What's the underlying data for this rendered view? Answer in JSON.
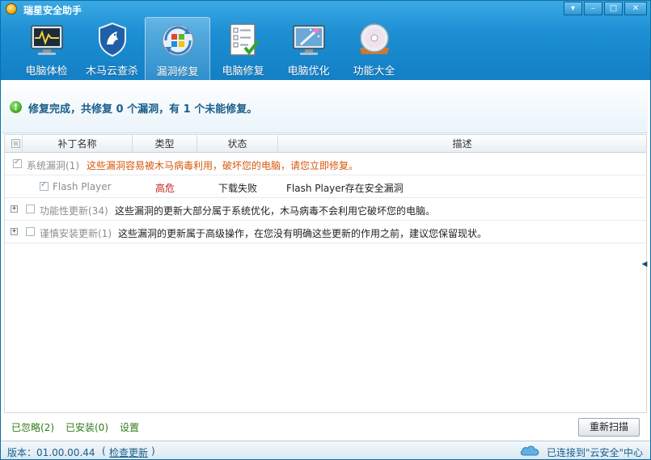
{
  "window": {
    "title": "瑞星安全助手",
    "controls": [
      "▾",
      "–",
      "□",
      "✕"
    ]
  },
  "nav": {
    "items": [
      {
        "label": "电脑体检",
        "icon": "monitor-health-icon"
      },
      {
        "label": "木马云查杀",
        "icon": "shield-horse-icon"
      },
      {
        "label": "漏洞修复",
        "icon": "windows-update-icon",
        "active": true
      },
      {
        "label": "电脑修复",
        "icon": "checklist-icon"
      },
      {
        "label": "电脑优化",
        "icon": "monitor-wand-icon"
      },
      {
        "label": "功能大全",
        "icon": "disc-icon"
      }
    ]
  },
  "status": {
    "message": "修复完成，共修复 0 个漏洞，有 1 个未能修复。"
  },
  "table": {
    "headers": {
      "name": "补丁名称",
      "type": "类型",
      "state": "状态",
      "desc": "描述"
    },
    "groups": [
      {
        "title": "系统漏洞(1)",
        "desc": "这些漏洞容易被木马病毒利用，破坏您的电脑，请您立即修复。",
        "checked": true
      },
      {
        "title": "功能性更新(34)",
        "desc": "这些漏洞的更新大部分属于系统优化，木马病毒不会利用它破坏您的电脑。",
        "checked": false
      },
      {
        "title": "谨慎安装更新(1)",
        "desc": "这些漏洞的更新属于高级操作，在您没有明确这些更新的作用之前，建议您保留现状。",
        "checked": false
      }
    ],
    "items": [
      {
        "name": "Flash Player",
        "type": "高危",
        "state": "下载失败",
        "desc": "Flash Player存在安全漏洞"
      }
    ]
  },
  "footer": {
    "ignored": "已忽略(2)",
    "installed": "已安装(0)",
    "settings": "设置",
    "rescan": "重新扫描"
  },
  "statusbar": {
    "version": "版本：01.00.00.44",
    "paren_open": "(",
    "update": "检查更新",
    "paren_close": ")",
    "connected": "已连接到\"云安全\"中心"
  },
  "colors": {
    "banner": "#1d8fd3",
    "accent_text": "#1a5e8a",
    "warning": "#d7580e",
    "danger": "#c0231d",
    "ok_green": "#3aa61d",
    "link_green": "#2e7b1a"
  }
}
